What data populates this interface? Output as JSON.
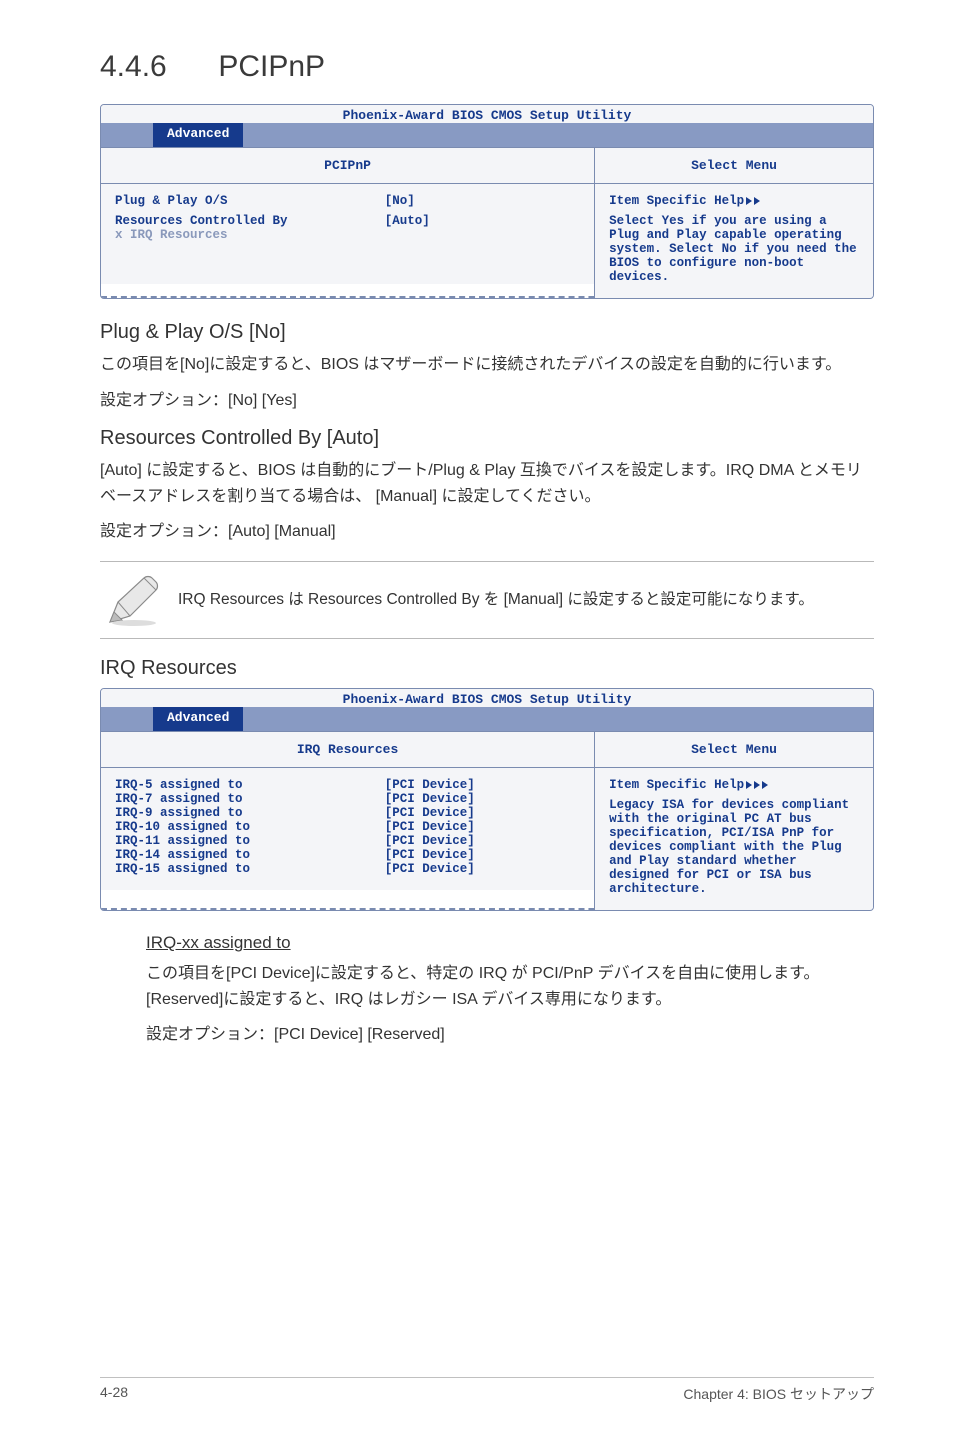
{
  "section": {
    "number": "4.4.6",
    "title": "PCIPnP"
  },
  "bios1": {
    "title": "Phoenix-Award BIOS CMOS Setup Utility",
    "tab": "Advanced",
    "left_header": "PCIPnP",
    "right_header": "Select Menu",
    "rows": [
      {
        "label": "Plug & Play O/S",
        "value": "[No]"
      },
      {
        "label": "Resources Controlled By",
        "value": "[Auto]"
      }
    ],
    "disabled_row": "x IRQ Resources",
    "help_title": "Item Specific Help",
    "help_body": "Select Yes if you are using a Plug and Play capable operating system. Select No if you need the BIOS to configure non-boot devices."
  },
  "sub1": {
    "heading": "Plug & Play O/S [No]",
    "line1": "この項目を[No]に設定すると、BIOS はマザーボードに接続されたデバイスの設定を自動的に行います。",
    "line2": "設定オプション：[No] [Yes]"
  },
  "sub2": {
    "heading": "Resources Controlled By [Auto]",
    "line1": "[Auto] に設定すると、BIOS は自動的にブート/Plug & Play 互換でバイスを設定します。IRQ DMA とメモリベースアドレスを割り当てる場合は、 [Manual] に設定してください。",
    "line2": "設定オプション：[Auto] [Manual]"
  },
  "note": "IRQ Resources は Resources Controlled By を [Manual] に設定すると設定可能になります。",
  "irq_heading": "IRQ Resources",
  "bios2": {
    "title": "Phoenix-Award BIOS CMOS Setup Utility",
    "tab": "Advanced",
    "left_header": "IRQ Resources",
    "right_header": "Select Menu",
    "rows": [
      {
        "label": "IRQ-5 assigned to",
        "value": "[PCI Device]"
      },
      {
        "label": "IRQ-7 assigned to",
        "value": "[PCI Device]"
      },
      {
        "label": "IRQ-9 assigned to",
        "value": "[PCI Device]"
      },
      {
        "label": "IRQ-10 assigned to",
        "value": "[PCI Device]"
      },
      {
        "label": "IRQ-11 assigned to",
        "value": "[PCI Device]"
      },
      {
        "label": "IRQ-14 assigned to",
        "value": "[PCI Device]"
      },
      {
        "label": "IRQ-15 assigned to",
        "value": "[PCI Device]"
      }
    ],
    "help_title": "Item Specific Help",
    "help_body": "Legacy ISA for devices compliant with the original PC AT bus specification, PCI/ISA PnP for devices compliant with the Plug and Play standard whether designed for PCI or ISA bus architecture."
  },
  "irqxx": {
    "heading": "IRQ-xx assigned to",
    "line1": "この項目を[PCI Device]に設定すると、特定の IRQ が PCI/PnP デバイスを自由に使用します。[Reserved]に設定すると、IRQ はレガシー ISA デバイス専用になります。",
    "line2": "設定オプション：[PCI Device] [Reserved]"
  },
  "footer": {
    "left": "4-28",
    "right": "Chapter 4: BIOS セットアップ"
  }
}
